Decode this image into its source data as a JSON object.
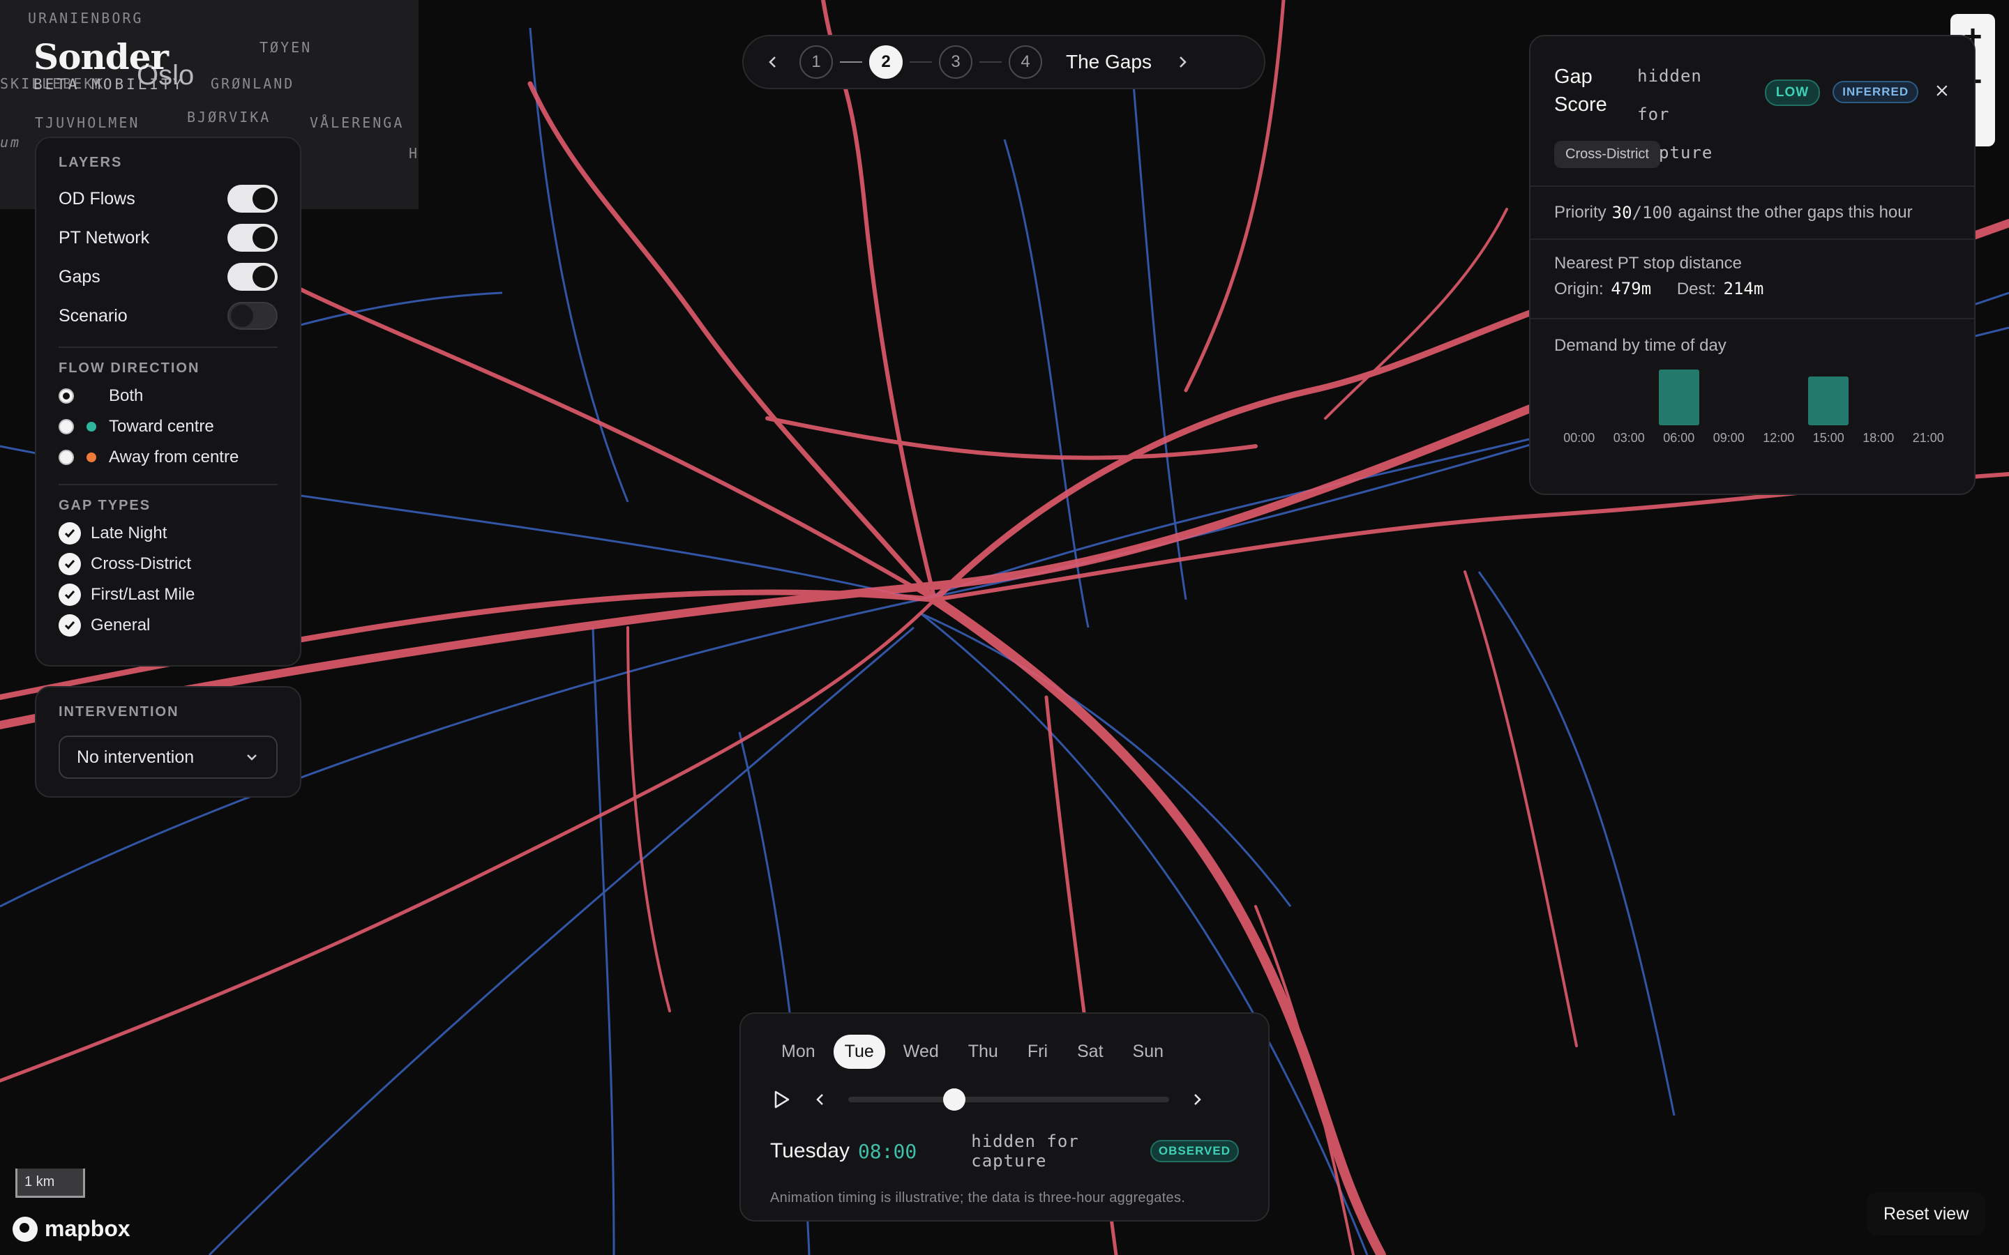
{
  "minimap": {
    "places": [
      "URANIENBORG",
      "TØYEN",
      "SKILLEBEKK",
      "GRØNLAND",
      "TJUVHOLMEN",
      "BJØRVIKA",
      "VÅLERENGA",
      "um",
      "H"
    ],
    "city": "Oslo"
  },
  "brand": {
    "name": "Sonder",
    "subtitle": "BETA MOBILITY"
  },
  "layers": {
    "title": "LAYERS",
    "items": [
      {
        "label": "OD Flows",
        "on": true
      },
      {
        "label": "PT Network",
        "on": true
      },
      {
        "label": "Gaps",
        "on": true
      },
      {
        "label": "Scenario",
        "on": false
      }
    ]
  },
  "flow_direction": {
    "title": "FLOW DIRECTION",
    "options": [
      {
        "label": "Both",
        "selected": true,
        "color": ""
      },
      {
        "label": "Toward centre",
        "selected": false,
        "color": "#2fb59c"
      },
      {
        "label": "Away from centre",
        "selected": false,
        "color": "#ef7a3a"
      }
    ]
  },
  "gap_types": {
    "title": "GAP TYPES",
    "items": [
      "Late Night",
      "Cross-District",
      "First/Last Mile",
      "General"
    ]
  },
  "intervention": {
    "title": "INTERVENTION",
    "value": "No intervention"
  },
  "stepper": {
    "steps": [
      "1",
      "2",
      "3",
      "4"
    ],
    "active": "2",
    "title": "The Gaps"
  },
  "gap_detail": {
    "title": "Gap Score",
    "hidden": "hidden for capture",
    "badge_level": "LOW",
    "badge_source": "INFERRED",
    "tag": "Cross-District",
    "priority_label": "Priority",
    "priority_value": "30",
    "priority_max": "/100",
    "priority_suffix": "against the other gaps this hour",
    "distance_title": "Nearest PT stop distance",
    "origin_label": "Origin:",
    "origin_value": "479m",
    "dest_label": "Dest:",
    "dest_value": "214m",
    "demand_title": "Demand by time of day",
    "demand_hours": [
      "00:00",
      "03:00",
      "06:00",
      "09:00",
      "12:00",
      "15:00",
      "18:00",
      "21:00"
    ],
    "demand_values": [
      0,
      0,
      1.0,
      0,
      0,
      0.88,
      0,
      0
    ],
    "bar_color": "#237a6c"
  },
  "timebar": {
    "days": [
      "Mon",
      "Tue",
      "Wed",
      "Thu",
      "Fri",
      "Sat",
      "Sun"
    ],
    "active_day": "Tue",
    "day_name": "Tuesday",
    "time": "08:00",
    "hidden": "hidden for capture",
    "badge": "OBSERVED",
    "note": "Animation timing is illustrative; the data is three-hour aggregates.",
    "slider_fraction": 0.33
  },
  "scale_label": "1 km",
  "attribution": "mapbox",
  "reset_label": "Reset view",
  "colors": {
    "flow": "#e05a6b",
    "pt_network": "#3f6fd8",
    "accent": "#3fbfa9",
    "background": "#0b0b0c"
  }
}
